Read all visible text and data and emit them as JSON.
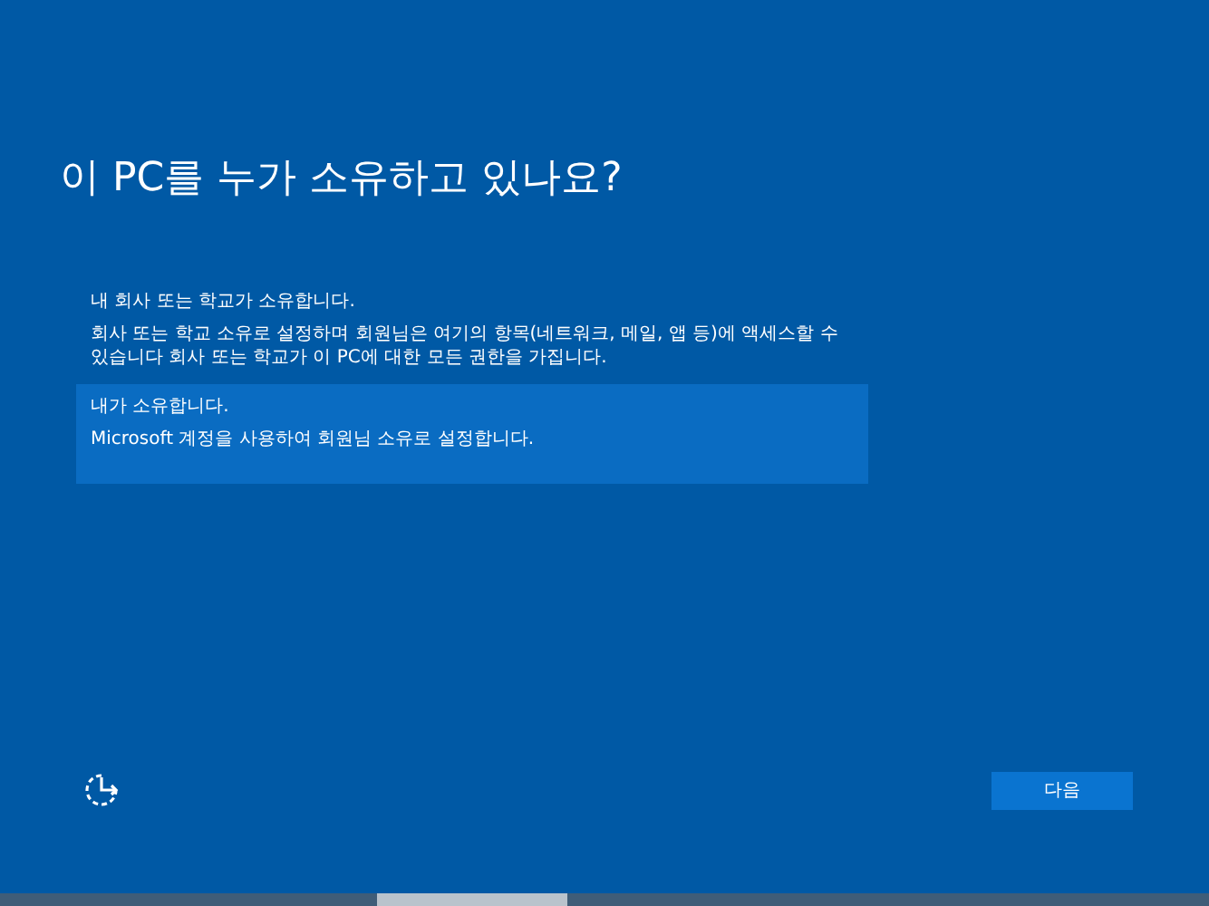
{
  "title": "이 PC를 누가 소유하고 있나요?",
  "options": [
    {
      "heading": "내 회사 또는 학교가 소유합니다.",
      "description": "회사 또는 학교 소유로 설정하며 회원님은 여기의 항목(네트워크, 메일, 앱 등)에 액세스할 수 있습니다 회사 또는 학교가 이 PC에 대한 모든 권한을 가집니다.",
      "selected": false
    },
    {
      "heading": "내가 소유합니다.",
      "description": "Microsoft 계정을 사용하여 회원님 소유로 설정합니다.",
      "selected": true
    }
  ],
  "next_button": "다음"
}
